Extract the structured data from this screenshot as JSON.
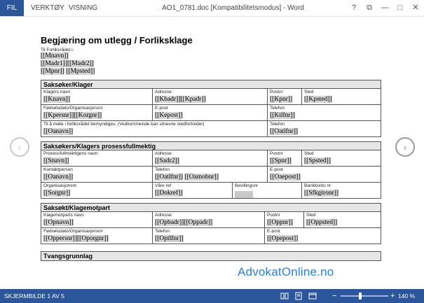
{
  "ribbon": {
    "file_tab": "FIL",
    "tabs": [
      "VERKTØY",
      "VISNING"
    ],
    "window_title": "AO1_0781.doc [Kompatibilitetsmodus] - Word"
  },
  "window_controls": {
    "help": "?",
    "restore": "⧉",
    "minimize": "—",
    "maximize": "□",
    "close": "✕"
  },
  "doc": {
    "title": "Begjæring om utlegg / Forliksklage",
    "to_label": "Til Forliksrådet i:",
    "addr1": "[[Mnavn]]",
    "addr2": "[[Madr1]][[Madr2]]",
    "addr3a": "[[Mpnr]]",
    "addr3b": "[[Mpsted]]",
    "s1": {
      "head": "Saksøker/Klager",
      "r1": [
        {
          "label": "Klagers navn",
          "value": "[[Knavn]]"
        },
        {
          "label": "Adresse",
          "value": "[[Kbadr]][[Kpadr]]"
        },
        {
          "label": "Postnr",
          "value": "[[Kpnr]]"
        },
        {
          "label": "Sted",
          "value": "[[Kpsted]]"
        }
      ],
      "r2": [
        {
          "label": "Fødselsdato/Organisasjonsnr",
          "value": "[[Kpersnr]][[Korgnr]]"
        },
        {
          "label": "E-post",
          "value": "[[Kepost]]"
        },
        {
          "label": "Telefon",
          "value": "[[Ktlfnr]]"
        }
      ],
      "r3": [
        {
          "label": "Til å møte i forliksrådet bemyndiges: (Vedkommende kan utnevne stedfortreder)",
          "value": "[[Oanavn]]"
        },
        {
          "label": "Telefon",
          "value": "[[Oatlfnr]]"
        }
      ]
    },
    "s2": {
      "head": "Saksøkers/Klagers prosessfullmektig",
      "r1": [
        {
          "label": "Prosessfullmektigens navn",
          "value": "[[Snavn]]"
        },
        {
          "label": "Adresse",
          "value": "[[Sadr2]]"
        },
        {
          "label": "Postnr",
          "value": "[[Spnr]]"
        },
        {
          "label": "Sted",
          "value": "[[Spsted]]"
        }
      ],
      "r2": [
        {
          "label": "Kontaktperson",
          "value": "[[Oanavn]]"
        },
        {
          "label": "Telefon",
          "value1": "[[Oatlfnr]]",
          "value2": "[[Oamobnr]]"
        },
        {
          "label": "E-post",
          "value": "[[Oaepost]]"
        }
      ],
      "r3": [
        {
          "label": "Organisasjonsnr",
          "value": "[[Sorgnr]]"
        },
        {
          "label": "Våre ref",
          "value": "[[Dokref]]"
        },
        {
          "label": "Bevillingsnr",
          "value": ""
        },
        {
          "label": "Bankkonto nr",
          "value": "[[Sfkgironr]]"
        }
      ]
    },
    "s3": {
      "head": "Saksøkt/Klagemotpart",
      "r1": [
        {
          "label": "Klagemotparts navn",
          "value": "[[Opnavn]]"
        },
        {
          "label": "Adresse",
          "value": "[[Opbadr]][[Oppadr]]"
        },
        {
          "label": "Postnr",
          "value": "[[Oppnr]]"
        },
        {
          "label": "Sted",
          "value": "[[Oppsted]]"
        }
      ],
      "r2": [
        {
          "label": "Fødselsdato/Organisasjonsnr",
          "value": "[[Oppersnr]][[Oporgnr]]"
        },
        {
          "label": "Telefon",
          "value": "[[Optlfnr]]"
        },
        {
          "label": "E-post",
          "value": "[[Opepost]]"
        }
      ]
    },
    "s4": {
      "head": "Tvangsgrunnlag"
    }
  },
  "watermark": "AdvokatOnline.no",
  "nav": {
    "prev_icon": "‹",
    "next_icon": "›"
  },
  "status": {
    "page_info": "SKJERMBILDE 1 AV 5",
    "zoom_minus": "−",
    "zoom_plus": "+",
    "zoom": "140 %",
    "zoom_level": 0.4
  },
  "colors": {
    "accent": "#2b579a",
    "watermark": "#2e7fd1"
  }
}
